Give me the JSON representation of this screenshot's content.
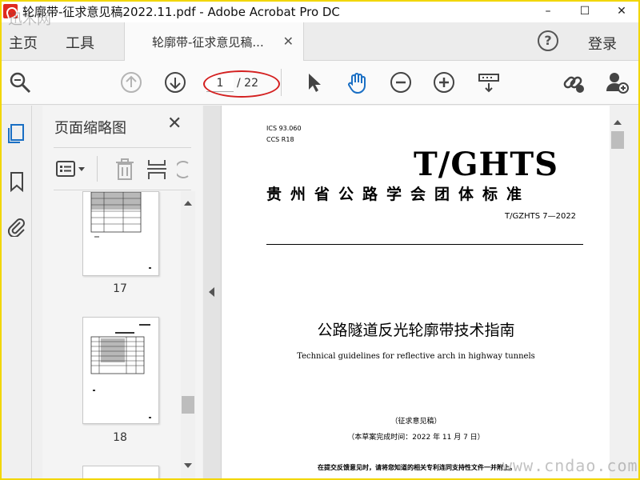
{
  "window": {
    "title": "轮廓带-征求意见稿2022.11.pdf - Adobe Acrobat Pro DC",
    "minimize": "–",
    "maximize": "☐",
    "close": "✕"
  },
  "menu": {
    "home": "主页",
    "tools": "工具",
    "doc_tab_title": "轮廓带-征求意见稿...",
    "doc_tab_close": "✕",
    "help": "?",
    "login": "登录"
  },
  "toolbar": {
    "current_page": "1",
    "total_pages": "/ 22",
    "icons": [
      "search-zoom-icon",
      "page-up-icon",
      "page-down-icon",
      "select-cursor-icon",
      "hand-tool-icon",
      "zoom-out-icon",
      "zoom-in-icon",
      "view-mode-icon",
      "share-link-icon",
      "add-user-icon"
    ],
    "accent": "#1a6fc4",
    "annotation_color": "#d42020"
  },
  "left_rail": {
    "icons": [
      "page-thumbnails-icon",
      "bookmark-icon",
      "attachment-icon"
    ]
  },
  "thumbnails": {
    "panel_title": "页面缩略图",
    "close": "✕",
    "pages": [
      {
        "number": "17"
      },
      {
        "number": "18"
      }
    ]
  },
  "document": {
    "ics": "ICS  93.060",
    "ccs": "CCS  R18",
    "brand": "T/GHTS",
    "standard_name": "贵州省公路学会团体标准",
    "standard_code": "T/GZHTS 7—2022",
    "title_cn": "公路隧道反光轮廓带技术指南",
    "title_en": "Technical guidelines for reflective arch in highway tunnels",
    "draft_label": "（征求意见稿）",
    "finish_date": "（本草案完成时间：2022 年 11 月 7 日）",
    "notice": "在提交反馈意见时，请将您知道的相关专利连同支持性文件一并附上。"
  },
  "watermarks": {
    "top_left": "迅木网",
    "bottom_right": "www.cndao.com"
  }
}
